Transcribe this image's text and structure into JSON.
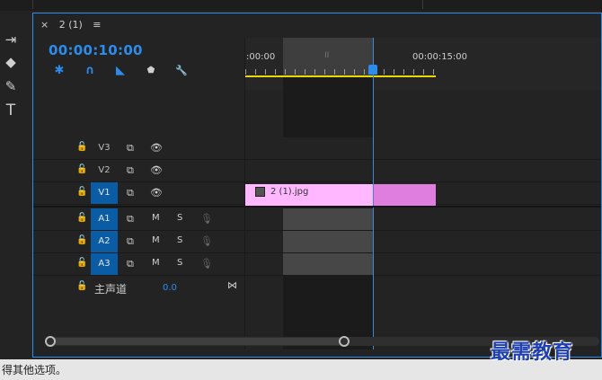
{
  "tab": {
    "close": "×",
    "title": "2 (1)",
    "menu": "≡"
  },
  "timecode": "00:00:10:00",
  "ruler": {
    "start": ":00:00",
    "mark": "00:00:15:00",
    "workarea_marker": "II"
  },
  "tools": {
    "select_track": "⇥",
    "razor": "◆",
    "pen": "✎",
    "text": "T"
  },
  "controls": {
    "nest": "✱",
    "snap": "∩",
    "linked": "◣",
    "marker": "⬟",
    "settings": "🔧"
  },
  "video_tracks": [
    {
      "label": "V3",
      "target": false
    },
    {
      "label": "V2",
      "target": false
    },
    {
      "label": "V1",
      "target": true
    }
  ],
  "audio_tracks": [
    {
      "label": "A1",
      "mute": "M",
      "solo": "S"
    },
    {
      "label": "A2",
      "mute": "M",
      "solo": "S"
    },
    {
      "label": "A3",
      "mute": "M",
      "solo": "S"
    }
  ],
  "master": {
    "label": "主声道",
    "value": "0.0"
  },
  "clip": {
    "name": "2 (1).jpg"
  },
  "status_text": "得其他选项。",
  "watermark": "最需教育"
}
